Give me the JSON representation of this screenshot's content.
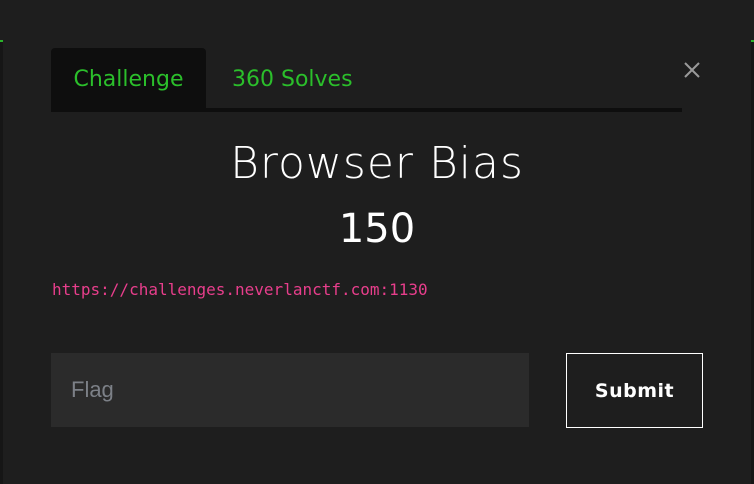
{
  "tabs": [
    {
      "label": "Challenge",
      "active": true
    },
    {
      "label": "360 Solves",
      "active": false
    }
  ],
  "close_icon": "close-icon",
  "challenge": {
    "title": "Browser Bias",
    "points": "150",
    "link": "https://challenges.neverlanctf.com:1130"
  },
  "form": {
    "flag_placeholder": "Flag",
    "flag_value": "",
    "submit_label": "Submit"
  },
  "colors": {
    "background": "#1e1e1e",
    "tab_active_bg": "#0e0e0e",
    "accent_green": "#2bbf2b",
    "link_pink": "#e83e8c",
    "input_bg": "#2b2b2b"
  }
}
